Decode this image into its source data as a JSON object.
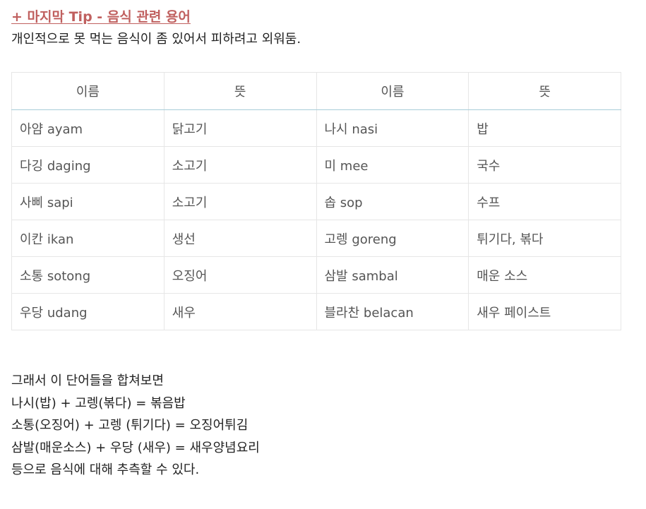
{
  "heading": "+ 마지막 Tip - 음식 관련 용어",
  "intro": "개인적으로 못 먹는 음식이 좀 있어서 피하려고 외워둠.",
  "table": {
    "headers": [
      "이름",
      "뜻",
      "이름",
      "뜻"
    ],
    "rows": [
      [
        "아얌 ayam",
        "닭고기",
        "나시 nasi",
        "밥"
      ],
      [
        "다깅 daging",
        "소고기",
        "미 mee",
        "국수"
      ],
      [
        "사삐 sapi",
        "소고기",
        "솝 sop",
        "수프"
      ],
      [
        "이칸 ikan",
        "생선",
        "고렝 goreng",
        "튀기다, 볶다"
      ],
      [
        "소통 sotong",
        "오징어",
        "삼발 sambal",
        "매운 소스"
      ],
      [
        "우당 udang",
        "새우",
        "블라찬 belacan",
        "새우 페이스트"
      ]
    ]
  },
  "summary": [
    "그래서 이 단어들을 합쳐보면",
    "나시(밥)  + 고렝(볶다) = 볶음밥",
    "소통(오징어) + 고렝 (튀기다) = 오징어튀김",
    "삼발(매운소스) + 우당 (새우) = 새우양념요리",
    "등으로 음식에 대해 추측할 수 있다."
  ]
}
